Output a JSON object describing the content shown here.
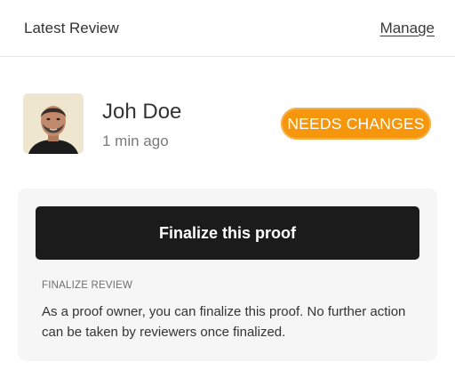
{
  "header": {
    "title": "Latest Review",
    "manage_label": "Manage"
  },
  "review": {
    "user_name": "Joh Doe",
    "timestamp": "1 min ago",
    "status": "NEEDS CHANGES",
    "status_color": "#f5960c",
    "avatar_icon": "person-avatar"
  },
  "finalize": {
    "button_label": "Finalize this proof",
    "section_label": "FINALIZE REVIEW",
    "description": "As a proof owner, you can finalize this proof. No further action can be taken by reviewers once finalized."
  }
}
